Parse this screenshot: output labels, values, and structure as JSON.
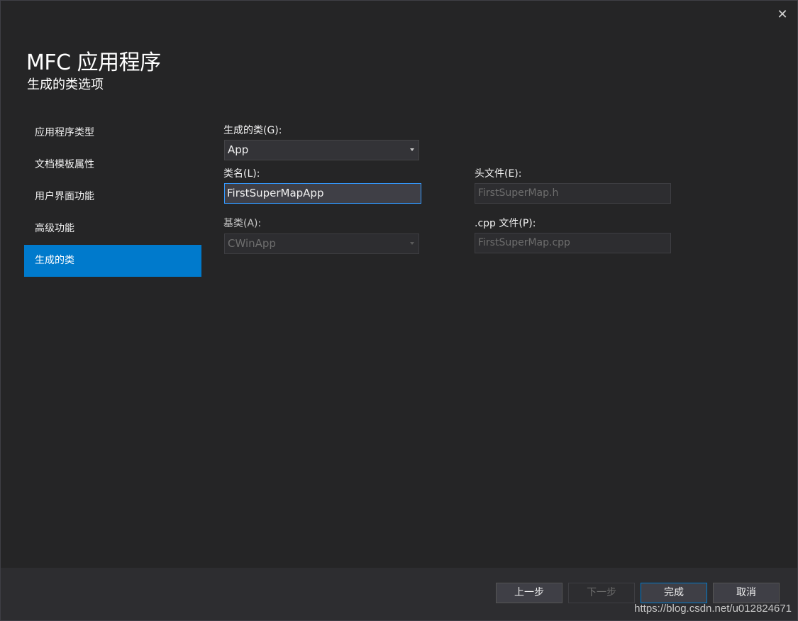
{
  "window": {
    "close_glyph": "✕",
    "title": "MFC 应用程序",
    "subtitle": "生成的类选项"
  },
  "nav": {
    "items": [
      {
        "label": "应用程序类型"
      },
      {
        "label": "文档模板属性"
      },
      {
        "label": "用户界面功能"
      },
      {
        "label": "高级功能"
      },
      {
        "label": "生成的类",
        "selected": true
      }
    ]
  },
  "form": {
    "generated_class": {
      "label": "生成的类(G):",
      "value": "App"
    },
    "class_name": {
      "label": "类名(L):",
      "value": "FirstSuperMapApp"
    },
    "header_file": {
      "label": "头文件(E):",
      "value": "FirstSuperMap.h"
    },
    "base_class": {
      "label": "基类(A):",
      "value": "CWinApp"
    },
    "cpp_file": {
      "label": ".cpp 文件(P):",
      "value": "FirstSuperMap.cpp"
    }
  },
  "footer": {
    "prev_label": "上一步",
    "next_label": "下一步",
    "finish_label": "完成",
    "cancel_label": "取消",
    "watermark": "https://blog.csdn.net/u012824671"
  },
  "colors": {
    "background": "#252526",
    "accent": "#007acc",
    "focus_border": "#3399ff",
    "footer": "#2d2d30"
  }
}
